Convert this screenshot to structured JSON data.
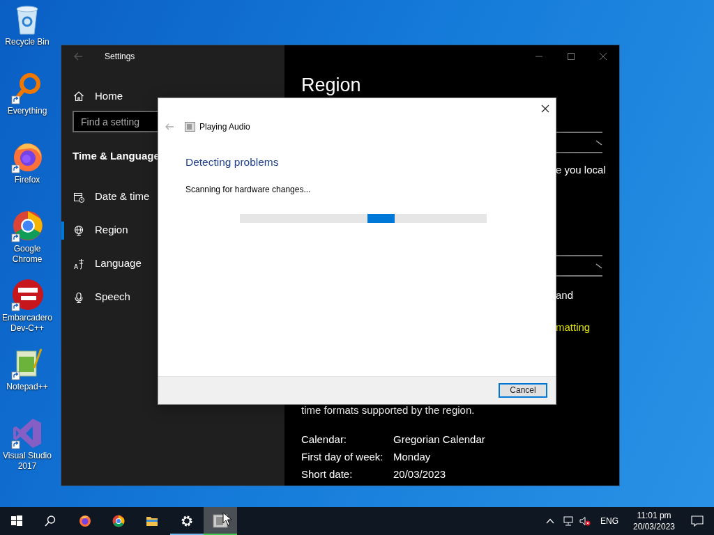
{
  "desktop_icons": [
    {
      "kind": "recycle",
      "label": "Recycle Bin",
      "shortcut": false
    },
    {
      "kind": "everything",
      "label": "Everything",
      "shortcut": true
    },
    {
      "kind": "firefox",
      "label": "Firefox",
      "shortcut": true
    },
    {
      "kind": "chrome",
      "label": "Google Chrome",
      "shortcut": true
    },
    {
      "kind": "devcpp",
      "label": "Embarcadero Dev-C++",
      "shortcut": true
    },
    {
      "kind": "notepadpp",
      "label": "Notepad++",
      "shortcut": true
    },
    {
      "kind": "vs",
      "label": "Visual Studio 2017",
      "shortcut": true
    }
  ],
  "settings_window": {
    "title": "Settings",
    "home": "Home",
    "search": {
      "placeholder": "Find a setting"
    },
    "section": "Time & Language",
    "nav": [
      {
        "kind": "calendar",
        "label": "Date & time",
        "selected": false
      },
      {
        "kind": "globe",
        "label": "Region",
        "selected": true
      },
      {
        "kind": "language",
        "label": "Language",
        "selected": false
      },
      {
        "kind": "microphone",
        "label": "Speech",
        "selected": false
      }
    ],
    "page_title": "Region",
    "content": [
      {
        "kind": "dropdown"
      },
      {
        "kind": "text",
        "text": "e you local"
      },
      {
        "kind": "dropdown"
      },
      {
        "kind": "text",
        "text": "and"
      },
      {
        "kind": "link",
        "text": "matting"
      },
      {
        "kind": "paragraph",
        "text": "time formats supported by the region."
      }
    ],
    "details": [
      {
        "label": "Calendar:",
        "value": "Gregorian Calendar"
      },
      {
        "label": "First day of week:",
        "value": "Monday"
      },
      {
        "label": "Short date:",
        "value": "20/03/2023"
      }
    ]
  },
  "dialog": {
    "title": "Playing Audio",
    "heading": "Detecting problems",
    "status": "Scanning for hardware changes...",
    "indeterminate": true,
    "cancel": "Cancel"
  },
  "taskbar": {
    "apps": [
      {
        "kind": "start",
        "running": false,
        "selected": false
      },
      {
        "kind": "search",
        "running": false,
        "selected": false
      },
      {
        "kind": "firefox",
        "running": false,
        "selected": false
      },
      {
        "kind": "chrome",
        "running": false,
        "selected": false
      },
      {
        "kind": "explorer",
        "running": false,
        "selected": false
      },
      {
        "kind": "settings",
        "running": true,
        "selected": false
      },
      {
        "kind": "troubleshooter",
        "running": true,
        "selected": true
      }
    ],
    "muted": true,
    "language": "ENG",
    "time": "11:01 pm",
    "date": "20/03/2023"
  }
}
